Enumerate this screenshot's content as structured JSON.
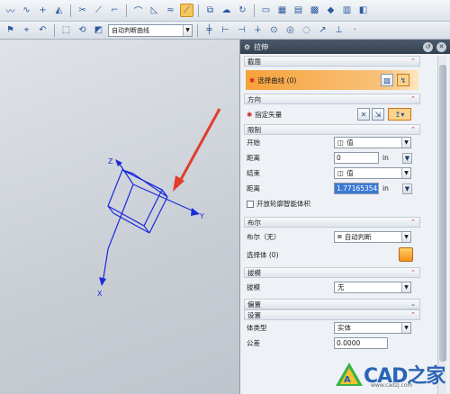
{
  "toolbar": {
    "curve_rule_combo": "自动判断曲线"
  },
  "dialog": {
    "title": "拉伸",
    "sections": {
      "section_label": "截面",
      "select_curve": "选择曲线 (0)",
      "direction_label": "方向",
      "specify_vector": "指定矢量",
      "limits_label": "限制",
      "start_label": "开始",
      "start_type": "值",
      "start_distance_label": "距离",
      "start_distance": "0",
      "end_label": "结束",
      "end_type": "值",
      "end_distance_label": "距离",
      "end_distance": "1.771653543",
      "unit": "in",
      "open_profile_label": "开放轮廓智能体积",
      "boolean_label": "布尔",
      "boolean_field_label": "布尔（无）",
      "boolean_value": "自动判断",
      "select_body": "选择体 (0)",
      "draft_label": "拔模",
      "draft_field_label": "拔模",
      "draft_value": "无",
      "offset_label": "偏置",
      "settings_label": "设置",
      "body_type_label": "体类型",
      "body_type_value": "实体",
      "tolerance_label": "公差",
      "tolerance_value": "0.0000"
    }
  },
  "viewport": {
    "axis_x": "X",
    "axis_y": "Y",
    "axis_z": "Z"
  },
  "watermark": {
    "text": "CAD之家",
    "url": "www.cadzj.com"
  },
  "colors": {
    "accent": "#f7a23b",
    "triad": "#1a2bdc",
    "arrow": "#e23c2c"
  }
}
